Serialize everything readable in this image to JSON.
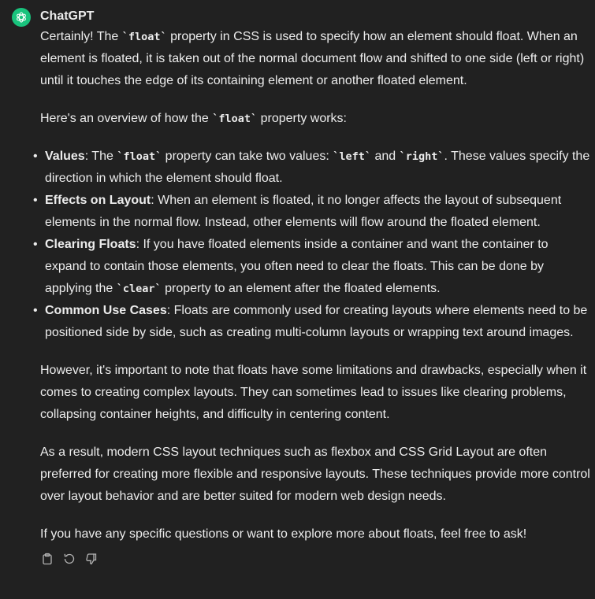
{
  "message": {
    "author": "ChatGPT",
    "intro_pre": "Certainly! The ",
    "intro_code": "`float`",
    "intro_post": " property in CSS is used to specify how an element should float. When an element is floated, it is taken out of the normal document flow and shifted to one side (left or right) until it touches the edge of its containing element or another floated element.",
    "overview_pre": "Here's an overview of how the ",
    "overview_code": "`float`",
    "overview_post": " property works:",
    "bullets": [
      {
        "title": "Values",
        "t1": ": The ",
        "c1": "`float`",
        "t2": " property can take two values: ",
        "c2": "`left`",
        "t3": " and ",
        "c3": "`right`",
        "t4": ". These values specify the direction in which the element should float."
      },
      {
        "title": "Effects on Layout",
        "text": ": When an element is floated, it no longer affects the layout of subsequent elements in the normal flow. Instead, other elements will flow around the floated element."
      },
      {
        "title": "Clearing Floats",
        "t1": ": If you have floated elements inside a container and want the container to expand to contain those elements, you often need to clear the floats. This can be done by applying the ",
        "c1": "`clear`",
        "t2": " property to an element after the floated elements."
      },
      {
        "title": "Common Use Cases",
        "text": ": Floats are commonly used for creating layouts where elements need to be positioned side by side, such as creating multi-column layouts or wrapping text around images."
      }
    ],
    "para_however": "However, it's important to note that floats have some limitations and drawbacks, especially when it comes to creating complex layouts. They can sometimes lead to issues like clearing problems, collapsing container heights, and difficulty in centering content.",
    "para_result": "As a result, modern CSS layout techniques such as flexbox and CSS Grid Layout are often preferred for creating more flexible and responsive layouts. These techniques provide more control over layout behavior and are better suited for modern web design needs.",
    "para_closing": "If you have any specific questions or want to explore more about floats, feel free to ask!"
  },
  "icons": {
    "avatar": "openai-logo-icon",
    "copy": "clipboard-icon",
    "regenerate": "refresh-icon",
    "dislike": "thumbs-down-icon"
  },
  "colors": {
    "background": "#212121",
    "text": "#ececec",
    "avatar_bg": "#19c37d",
    "icon": "#b4b4b4"
  }
}
